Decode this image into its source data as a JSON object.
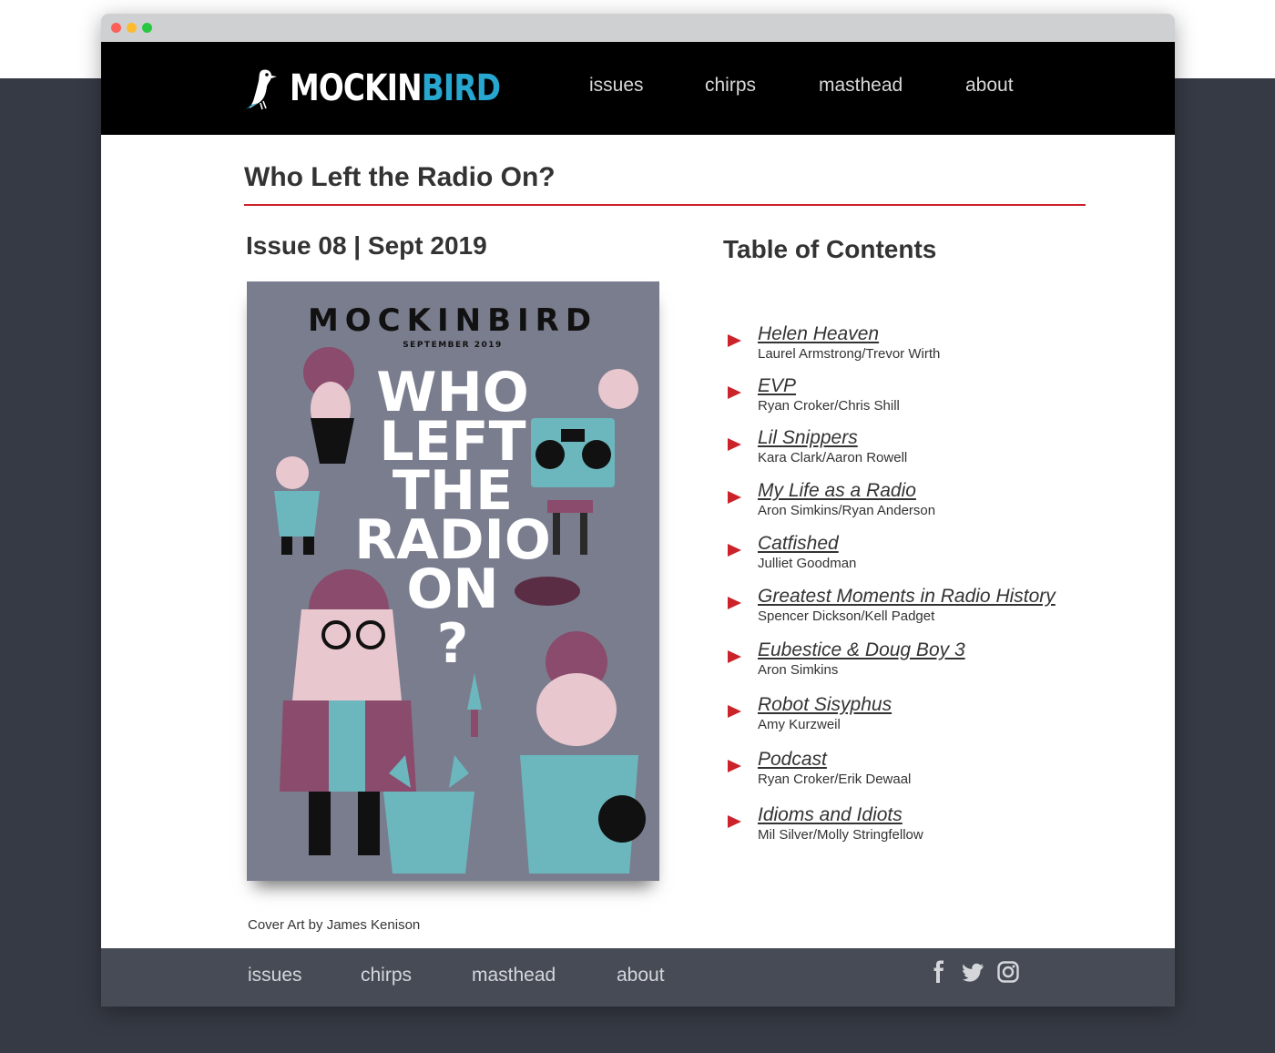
{
  "brand": {
    "name_part1": "MOCKIN",
    "name_part2": "BIRD",
    "accent_color": "#27a6cf",
    "rule_color": "#cc2229"
  },
  "nav": {
    "items": [
      {
        "label": "issues"
      },
      {
        "label": "chirps"
      },
      {
        "label": "masthead"
      },
      {
        "label": "about"
      }
    ]
  },
  "page": {
    "title": "Who Left the Radio On?",
    "issue_heading": "Issue 08 | Sept 2019",
    "cover_credit": "Cover Art by James Kenison"
  },
  "cover": {
    "masthead": "MOCKINBIRD",
    "date": "SEPTEMBER 2019",
    "headline_lines": [
      "WHO",
      "LEFT",
      "THE",
      "RADIO",
      "ON"
    ],
    "question_mark": "?"
  },
  "toc": {
    "heading": "Table of Contents",
    "items": [
      {
        "title": "Helen Heaven",
        "author": "Laurel Armstrong/Trevor Wirth"
      },
      {
        "title": "EVP",
        "author": "Ryan Croker/Chris Shill"
      },
      {
        "title": "Lil Snippers",
        "author": "Kara Clark/Aaron Rowell"
      },
      {
        "title": "My Life as a Radio",
        "author": "Aron Simkins/Ryan Anderson"
      },
      {
        "title": "Catfished",
        "author": "Julliet Goodman"
      },
      {
        "title": "Greatest Moments in Radio History",
        "author": "Spencer Dickson/Kell Padget"
      },
      {
        "title": "Eubestice & Doug Boy 3",
        "author": "Aron Simkins"
      },
      {
        "title": "Robot Sisyphus",
        "author": "Amy Kurzweil"
      },
      {
        "title": "Podcast",
        "author": "Ryan Croker/Erik Dewaal"
      },
      {
        "title": "Idioms and Idiots",
        "author": "Mil Silver/Molly Stringfellow"
      }
    ]
  },
  "footer": {
    "nav": [
      {
        "label": "issues"
      },
      {
        "label": "chirps"
      },
      {
        "label": "masthead"
      },
      {
        "label": "about"
      }
    ],
    "social": [
      "facebook-icon",
      "twitter-icon",
      "instagram-icon"
    ]
  }
}
